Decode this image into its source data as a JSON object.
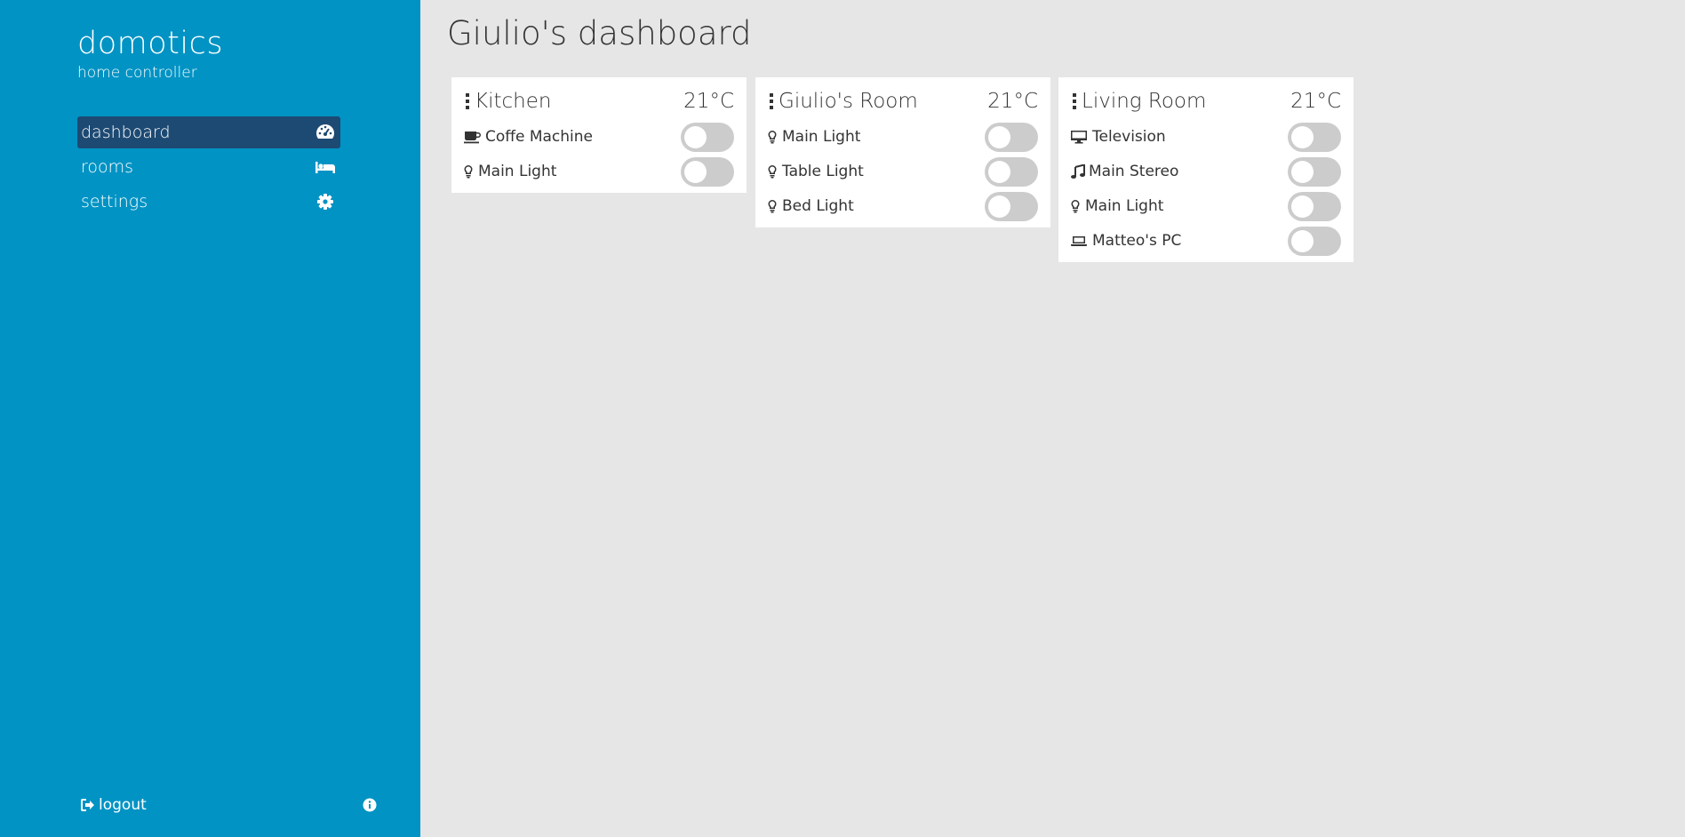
{
  "sidebar": {
    "brand_title": "domotics",
    "brand_subtitle": "home controller",
    "nav": [
      {
        "label": "dashboard",
        "icon": "tachometer-icon",
        "active": true
      },
      {
        "label": "rooms",
        "icon": "bed-icon",
        "active": false
      },
      {
        "label": "settings",
        "icon": "gear-icon",
        "active": false
      }
    ],
    "logout_label": "logout",
    "colors": {
      "background": "#0093c4",
      "active_item": "#1d4a73"
    }
  },
  "main": {
    "title": "Giulio's dashboard",
    "rooms": [
      {
        "name": "Kitchen",
        "temperature": "21°C",
        "devices": [
          {
            "label": "Coffe Machine",
            "icon": "coffee-icon",
            "on": false
          },
          {
            "label": "Main Light",
            "icon": "lightbulb-icon",
            "on": false
          }
        ]
      },
      {
        "name": "Giulio's Room",
        "temperature": "21°C",
        "devices": [
          {
            "label": "Main Light",
            "icon": "lightbulb-icon",
            "on": false
          },
          {
            "label": "Table Light",
            "icon": "lightbulb-icon",
            "on": false
          },
          {
            "label": "Bed Light",
            "icon": "lightbulb-icon",
            "on": false
          }
        ]
      },
      {
        "name": "Living Room",
        "temperature": "21°C",
        "devices": [
          {
            "label": "Television",
            "icon": "monitor-icon",
            "on": false
          },
          {
            "label": "Main Stereo",
            "icon": "music-icon",
            "on": false
          },
          {
            "label": "Main Light",
            "icon": "lightbulb-icon",
            "on": false
          },
          {
            "label": "Matteo's PC",
            "icon": "laptop-icon",
            "on": false
          }
        ]
      }
    ],
    "colors": {
      "background": "#e6e6e6",
      "card": "#ffffff",
      "toggle_off": "#cccccc"
    }
  }
}
